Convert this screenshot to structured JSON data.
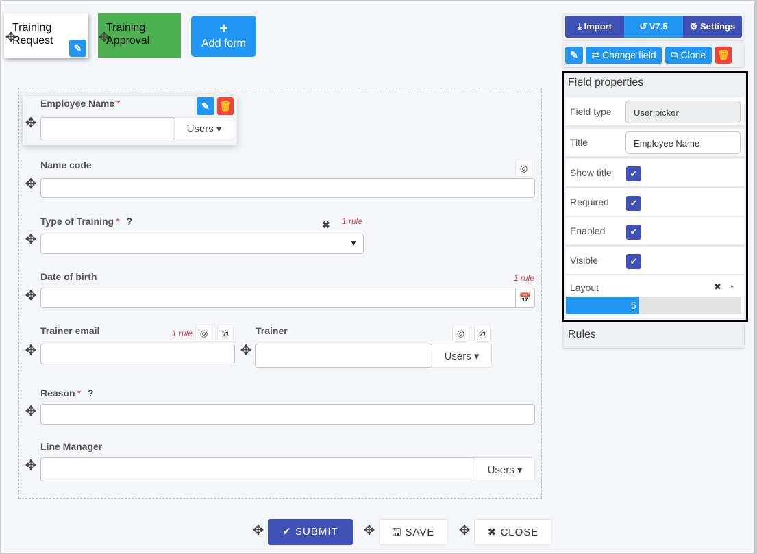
{
  "tabs": [
    {
      "label": "Training Request",
      "active": true
    },
    {
      "label": "Training Approval",
      "color": "#4caf50"
    }
  ],
  "add_form": {
    "icon": "plus-icon",
    "label": "Add form"
  },
  "fields": {
    "employee_name": {
      "label": "Employee Name",
      "required": "*",
      "addon": "Users"
    },
    "name_code": {
      "label": "Name code"
    },
    "type_of_training": {
      "label": "Type of Training",
      "required": "*",
      "help": "?",
      "rule": "1 rule"
    },
    "date_of_birth": {
      "label": "Date of birth",
      "rule": "1 rule"
    },
    "trainer_email": {
      "label": "Trainer email",
      "rule": "1 rule"
    },
    "trainer": {
      "label": "Trainer",
      "addon": "Users"
    },
    "reason": {
      "label": "Reason",
      "required": "*",
      "help": "?"
    },
    "line_manager": {
      "label": "Line Manager",
      "addon": "Users"
    }
  },
  "footer": {
    "submit": "SUBMIT",
    "save": "SAVE",
    "close": "CLOSE"
  },
  "toolbar": {
    "import": "Import",
    "version": "V7.5",
    "settings": "Settings",
    "change_field": "Change field",
    "clone": "Clone"
  },
  "properties": {
    "title": "Field properties",
    "field_type_label": "Field type",
    "field_type_value": "User picker",
    "title_label": "Title",
    "title_value": "Employee Name",
    "show_title": "Show title",
    "required": "Required",
    "enabled": "Enabled",
    "visible": "Visible",
    "checks": {
      "show_title": true,
      "required": true,
      "enabled": true,
      "visible": true
    },
    "layout_label": "Layout",
    "layout_value": "5",
    "layout_max": 12
  },
  "rules": {
    "title": "Rules"
  },
  "colors": {
    "primary": "#2196f3",
    "indigo": "#3f51b5",
    "danger": "#f44336",
    "success": "#4caf50"
  }
}
